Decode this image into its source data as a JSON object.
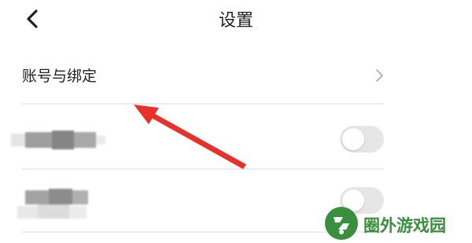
{
  "header": {
    "title": "设置",
    "back_icon": "chevron-left-icon"
  },
  "settings": {
    "account_binding": {
      "label": "账号与绑定",
      "icon": "chevron-right-icon"
    },
    "toggles": [
      {
        "state": "off",
        "label": ""
      },
      {
        "state": "off",
        "label": ""
      }
    ]
  },
  "annotation": {
    "arrow_color": "#e8312b"
  },
  "watermark": {
    "text": "圈外游戏园",
    "color": "#3a8f3e"
  }
}
